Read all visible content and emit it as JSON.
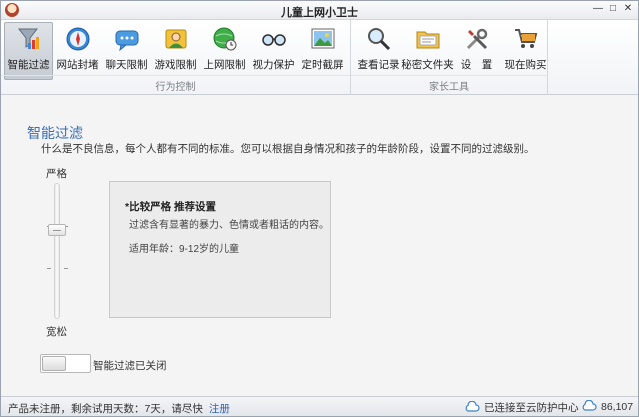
{
  "window": {
    "title": "儿童上网小卫士",
    "controls": {
      "minimize": "—",
      "maximize": "□",
      "close": "✕"
    }
  },
  "toolbar": {
    "groups": [
      {
        "label": "行为控制",
        "buttons": [
          {
            "label": "智能过滤",
            "icon": "filter-funnel-icon",
            "active": true
          },
          {
            "label": "网站封堵",
            "icon": "compass-icon",
            "active": false
          },
          {
            "label": "聊天限制",
            "icon": "chat-bubble-icon",
            "active": false
          },
          {
            "label": "游戏限制",
            "icon": "game-person-icon",
            "active": false
          },
          {
            "label": "上网限制",
            "icon": "globe-icon",
            "active": false
          },
          {
            "label": "视力保护",
            "icon": "glasses-icon",
            "active": false
          },
          {
            "label": "定时截屏",
            "icon": "picture-icon",
            "active": false
          }
        ]
      },
      {
        "label": "家长工具",
        "buttons": [
          {
            "label": "查看记录",
            "icon": "magnifier-icon",
            "active": false
          },
          {
            "label": "秘密文件夹",
            "icon": "folder-icon",
            "active": false
          },
          {
            "label": "设　置",
            "icon": "tools-icon",
            "active": false
          },
          {
            "label": "现在购买",
            "icon": "cart-icon",
            "active": false
          }
        ]
      }
    ]
  },
  "main": {
    "title": "智能过滤",
    "description": "什么是不良信息，每个人都有不同的标准。您可以根据自身情况和孩子的年龄阶段，设置不同的过滤级别。",
    "slider": {
      "top_label": "严格",
      "bottom_label": "宽松",
      "level": 0.33
    },
    "panel": {
      "title": "*比较严格 推荐设置",
      "line1": "过滤含有显著的暴力、色情或者粗话的内容。",
      "line2": "适用年龄：9-12岁的儿童"
    },
    "toggle": {
      "label": "智能过滤已关闭",
      "on": false
    }
  },
  "statusbar": {
    "trial_text": "产品未注册，剩余试用天数：7天，请尽快",
    "register_link": "注册",
    "cloud_status": "已连接至云防护中心",
    "cloud_count": "86,107"
  },
  "colors": {
    "accent": "#3a6eb4",
    "link": "#2f62b5"
  }
}
